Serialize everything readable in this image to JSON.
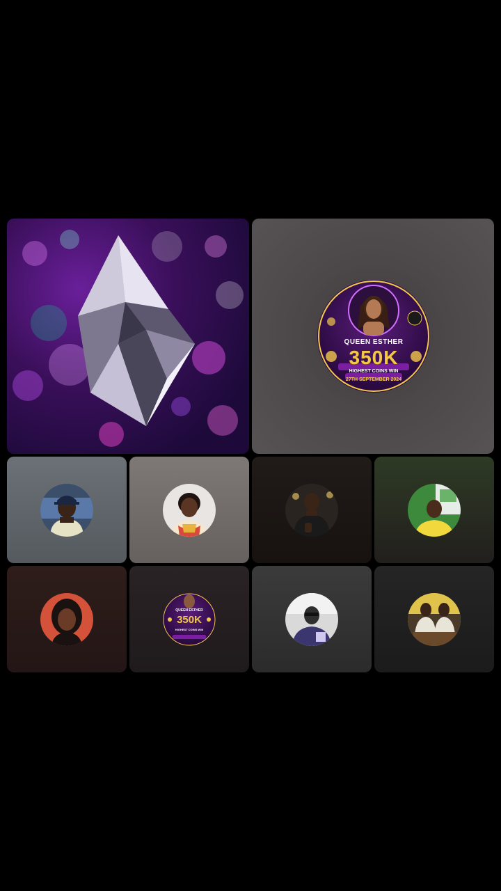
{
  "grid": {
    "host_tile": {
      "content": "diamond-gift-animation"
    },
    "guest_tile": {
      "banner": {
        "name": "QUEEN ESTHER",
        "target": "350K",
        "subtitle": "HIGHEST COINS WIN",
        "date": "27TH SEPTEMBER 2024"
      }
    },
    "participants": [
      {
        "avatar": "avatar-man-cap-icon"
      },
      {
        "avatar": "avatar-woman-icon"
      },
      {
        "avatar": "avatar-man-jersey-icon"
      },
      {
        "avatar": "avatar-man-yellow-icon"
      },
      {
        "avatar": "avatar-woman-red-icon"
      },
      {
        "avatar": "avatar-banner-icon",
        "banner": {
          "name": "QUEEN ESTHER",
          "target": "350K",
          "subtitle": "HIGHEST COINS WIN"
        }
      },
      {
        "avatar": "avatar-man-car-icon"
      },
      {
        "avatar": "avatar-group-icon"
      }
    ]
  },
  "colors": {
    "background": "#000000",
    "gold": "#f2c84b",
    "purple": "#5a1d7a"
  }
}
